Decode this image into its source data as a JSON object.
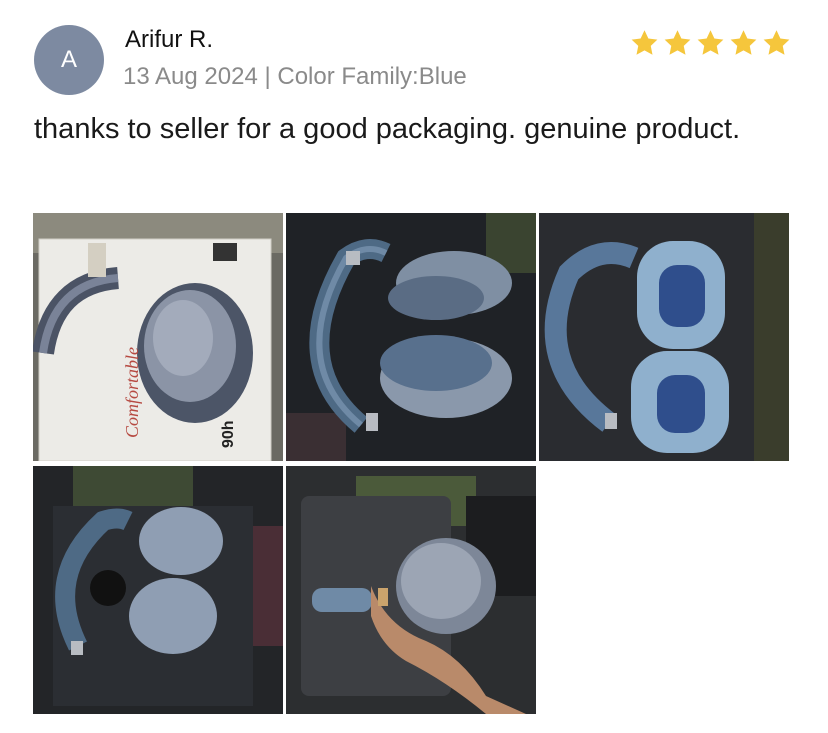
{
  "review": {
    "avatar_initial": "A",
    "reviewer_name": "Arifur R.",
    "meta_line": "13 Aug 2024 | Color Family:Blue",
    "rating": 5,
    "star_color": "#f5c63c",
    "text": "thanks to seller for a good packaging. genuine product."
  },
  "photos": [
    {
      "name": "photo-box",
      "icon": "headphone-box-photo",
      "box_text": "Comfortable",
      "box_hours": "90h"
    },
    {
      "name": "photo-headphones-top",
      "icon": "headphone-photo"
    },
    {
      "name": "photo-ear-cushions",
      "icon": "ear-cushion-photo"
    },
    {
      "name": "photo-headphones-folded",
      "icon": "headphone-photo"
    },
    {
      "name": "photo-headphones-in-hand",
      "icon": "hand-holding-headphone-photo"
    }
  ]
}
